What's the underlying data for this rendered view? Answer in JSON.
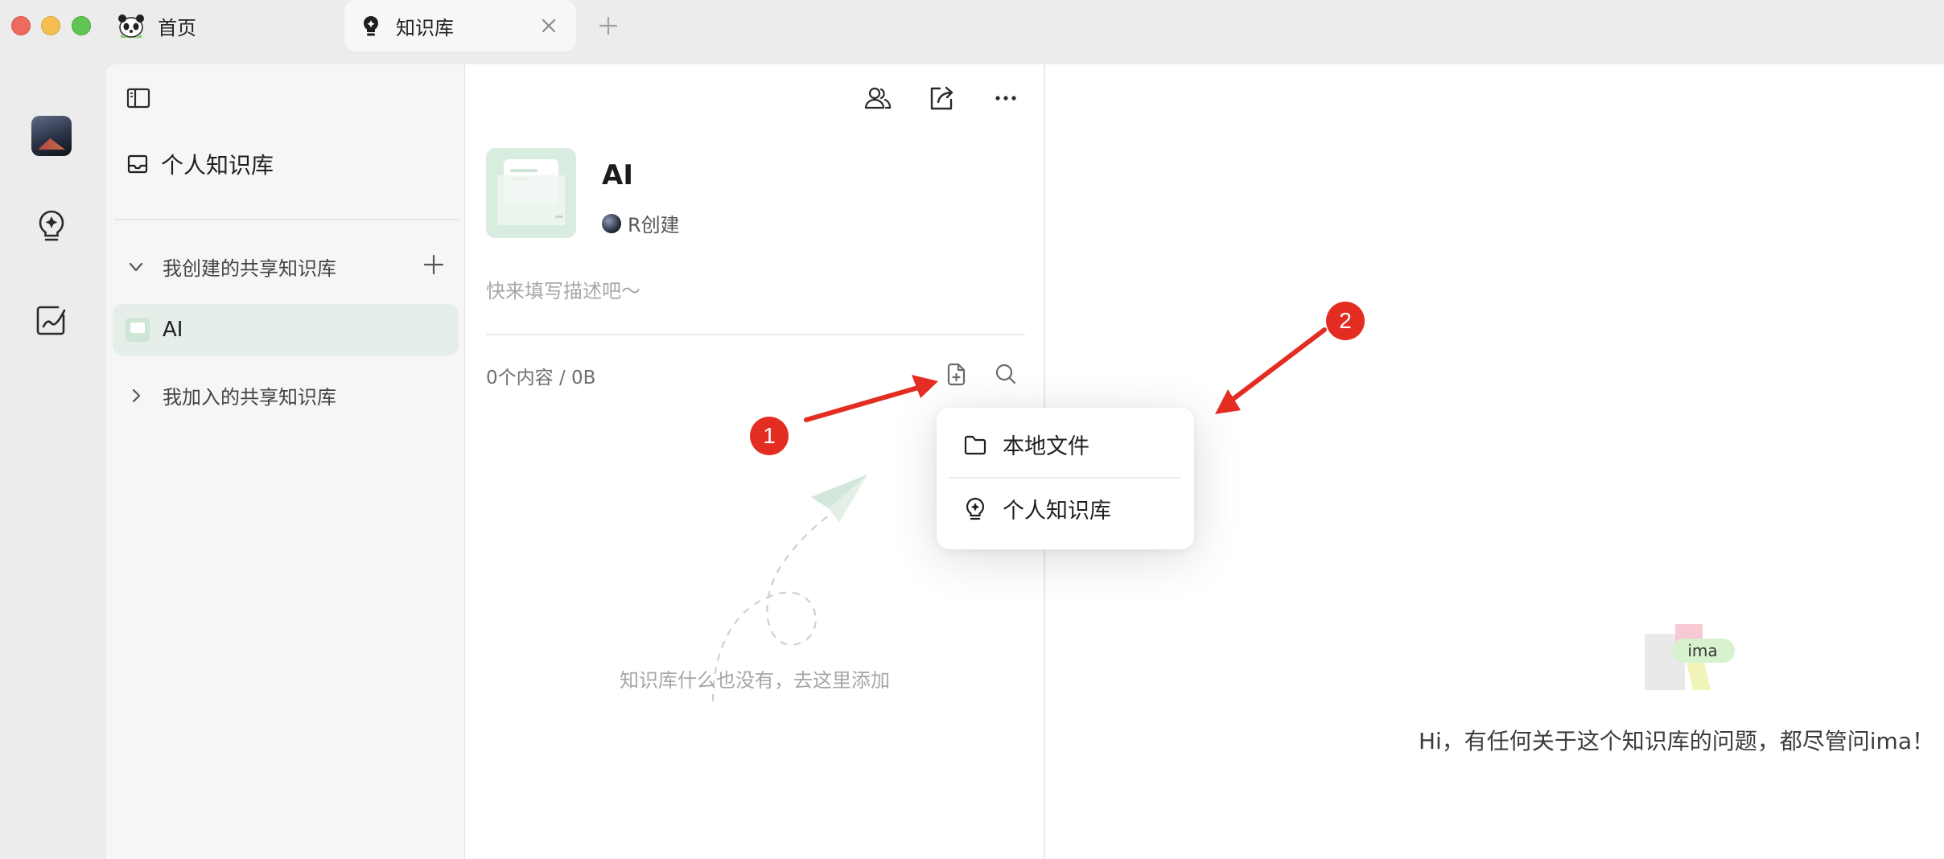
{
  "titlebar": {
    "tabs": [
      {
        "label": "首页"
      },
      {
        "label": "知识库"
      }
    ]
  },
  "sidebar": {
    "personal_kb": "个人知识库",
    "groups": {
      "created": "我创建的共享知识库",
      "joined": "我加入的共享知识库"
    },
    "items": [
      {
        "label": "AI"
      }
    ]
  },
  "kb": {
    "title": "AI",
    "creator": "R创建",
    "description_placeholder": "快来填写描述吧～",
    "stats": "0个内容 / 0B",
    "empty_message": "知识库什么也没有，去这里添加"
  },
  "menu": {
    "items": [
      {
        "label": "本地文件",
        "icon": "folder-icon"
      },
      {
        "label": "个人知识库",
        "icon": "lightbulb-icon"
      }
    ]
  },
  "right_panel": {
    "logo_text": "ima",
    "message": "Hi，有任何关于这个知识库的问题，都尽管问ima！"
  },
  "annotations": {
    "badge_1": "1",
    "badge_2": "2",
    "color": "#e32d22"
  },
  "colors": {
    "accent_green_bg": "#e5eee8",
    "annotation_red": "#e32d22"
  }
}
